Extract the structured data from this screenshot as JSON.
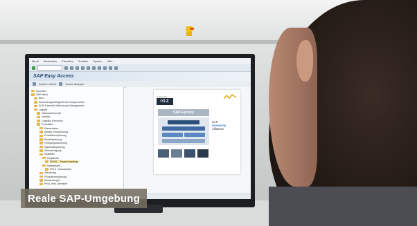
{
  "photo": {
    "caption": "Reale SAP-Umgebung"
  },
  "sap": {
    "menu": [
      "Menü",
      "Bearbeiten",
      "Favoriten",
      "Zusätze",
      "System",
      "Hilfe"
    ],
    "title": "SAP Easy Access",
    "appbar": [
      "Anderer Menü",
      "Suche anlegen"
    ],
    "tree": [
      {
        "label": "Favoriten",
        "level": 0
      },
      {
        "label": "SAP Menü",
        "level": 0
      },
      {
        "label": "Büro",
        "level": 1
      },
      {
        "label": "Anwendungsübergreifende Komponenten",
        "level": 1
      },
      {
        "label": "SCM Extended Warehouse Management",
        "level": 1
      },
      {
        "label": "Logistik",
        "level": 1
      },
      {
        "label": "Materialwirtschaft",
        "level": 2
      },
      {
        "label": "Vertrieb",
        "level": 2
      },
      {
        "label": "Logistics Execution",
        "level": 2
      },
      {
        "label": "Produktion",
        "level": 2
      },
      {
        "label": "Stammdaten",
        "level": 3
      },
      {
        "label": "Absatz-/Grobplanung",
        "level": 3
      },
      {
        "label": "Produktionsplanung",
        "level": 3
      },
      {
        "label": "Bedarfsplanung",
        "level": 3
      },
      {
        "label": "Fertigungssteuerung",
        "level": 3
      },
      {
        "label": "Kapazitätsplanung",
        "level": 3
      },
      {
        "label": "Serienfertigung",
        "level": 3
      },
      {
        "label": "KANBAN",
        "level": 3
      },
      {
        "label": "Regelkreis",
        "level": 4
      },
      {
        "label": "PK05C - Regelkreispflege",
        "level": 5,
        "selected": true
      },
      {
        "label": "Kanbantafel",
        "level": 4
      },
      {
        "label": "PK13 - Kanbantafel",
        "level": 5
      },
      {
        "label": "Steuerung",
        "level": 3
      },
      {
        "label": "Produktionsplanung",
        "level": 3
      },
      {
        "label": "Auswertungen",
        "level": 3
      },
      {
        "label": "Prod.-Vers.-Bereiche",
        "level": 3
      }
    ],
    "graphic": {
      "powered_by": "powered by",
      "logo": "IGZ",
      "factory": "SAP-Factory",
      "ua_line1": "SAP",
      "ua_line2": "University",
      "ua_line3": "Alliances"
    },
    "colors": {
      "title": "#2b4a70",
      "caption_bg": "#766e62",
      "folder": "#e5b84d"
    }
  }
}
